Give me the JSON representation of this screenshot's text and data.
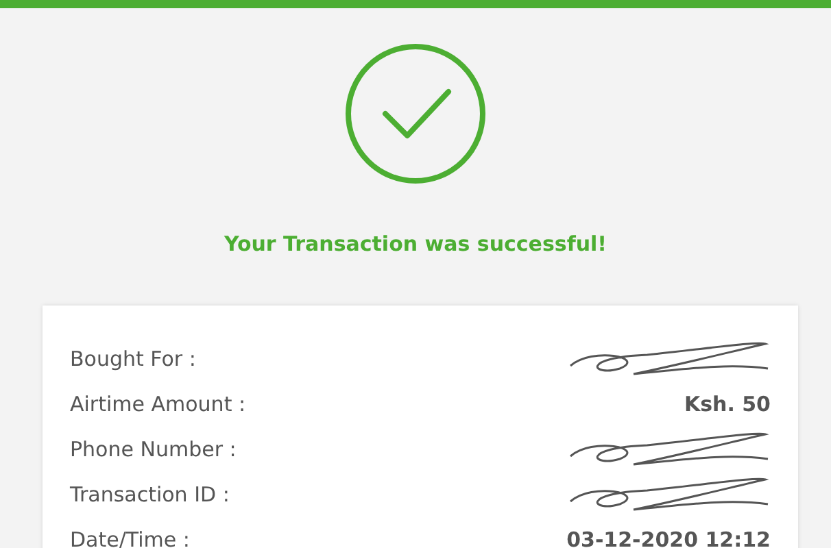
{
  "status": {
    "message": "Your Transaction was successful!"
  },
  "details": [
    {
      "label": "Bought For :",
      "redacted": true
    },
    {
      "label": "Airtime Amount :",
      "value": "Ksh. 50",
      "redacted": false
    },
    {
      "label": "Phone Number :",
      "redacted": true
    },
    {
      "label": "Transaction ID :",
      "redacted": true
    },
    {
      "label": "Date/Time :",
      "value": "03-12-2020 12:12",
      "redacted": false
    }
  ]
}
